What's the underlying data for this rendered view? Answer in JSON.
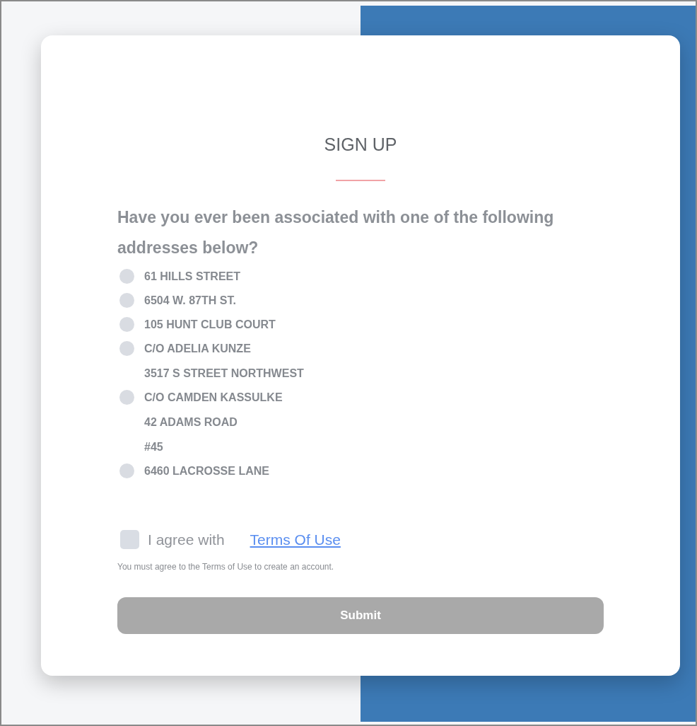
{
  "title": "SIGN UP",
  "question": "Have you ever been associated with one of the following addresses below?",
  "addresses": [
    {
      "lines": [
        "61 HILLS STREET"
      ],
      "selected": false
    },
    {
      "lines": [
        "6504 W. 87TH ST."
      ],
      "selected": false
    },
    {
      "lines": [
        "105 HUNT CLUB COURT"
      ],
      "selected": false
    },
    {
      "lines": [
        "C/O ADELIA KUNZE",
        "3517 S STREET NORTHWEST"
      ],
      "selected": false
    },
    {
      "lines": [
        "C/O CAMDEN KASSULKE",
        "42 ADAMS ROAD",
        "#45"
      ],
      "selected": false
    },
    {
      "lines": [
        "6460 LACROSSE LANE"
      ],
      "selected": false
    }
  ],
  "agree": {
    "label": "I agree with",
    "link": "Terms Of Use",
    "checked": false
  },
  "note": "You must agree to the Terms of Use to create an account.",
  "submit": {
    "label": "Submit",
    "disabled": true
  }
}
